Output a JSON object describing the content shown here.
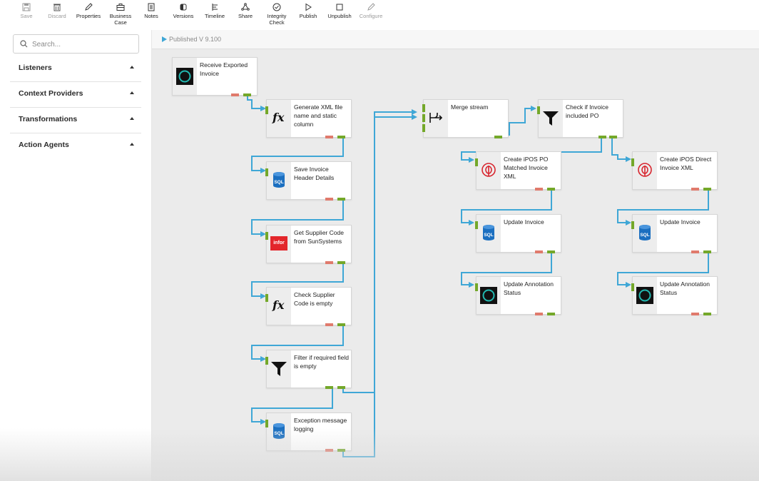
{
  "toolbar": {
    "save": "Save",
    "discard": "Discard",
    "properties": "Properties",
    "business_case_1": "Business",
    "business_case_2": "Case",
    "notes": "Notes",
    "versions": "Versions",
    "timeline": "Timeline",
    "share": "Share",
    "integrity_1": "Integrity",
    "integrity_2": "Check",
    "publish": "Publish",
    "unpublish": "Unpublish",
    "configure": "Configure"
  },
  "sidebar": {
    "search_placeholder": "Search...",
    "sections": [
      "Listeners",
      "Context Providers",
      "Transformations",
      "Action Agents"
    ]
  },
  "canvas": {
    "published": "Published V 9.100"
  },
  "nodes": {
    "receive": "Receive Exported Invoice",
    "generate": "Generate XML file name and static column",
    "save_header": "Save Invoice Header Details",
    "supplier_code": "Get Supplier Code from SunSystems",
    "check_supplier": "Check Supplier Code is empty",
    "filter": "Filter if required field is empty",
    "exception": "Exception message logging",
    "merge": "Merge stream",
    "check_po": "Check if Invoice included PO",
    "create_po": "Create iPOS PO Matched Invoice XML",
    "create_direct": "Create iPOS Direct Invoice XML",
    "update_po": "Update Invoice",
    "update_direct": "Update Invoice",
    "annot_po": "Update Annotation Status",
    "annot_direct": "Update Annotation Status"
  },
  "icons": {
    "fx": "fx",
    "sql": "SQL",
    "infor": "infor"
  },
  "colors": {
    "wire": "#3fa7d6",
    "port_green": "#74a82a",
    "port_red": "#e07a6c",
    "infor_red": "#e3262b",
    "sql_blue": "#1b6fc0",
    "listener_teal": "#22b8b0"
  }
}
